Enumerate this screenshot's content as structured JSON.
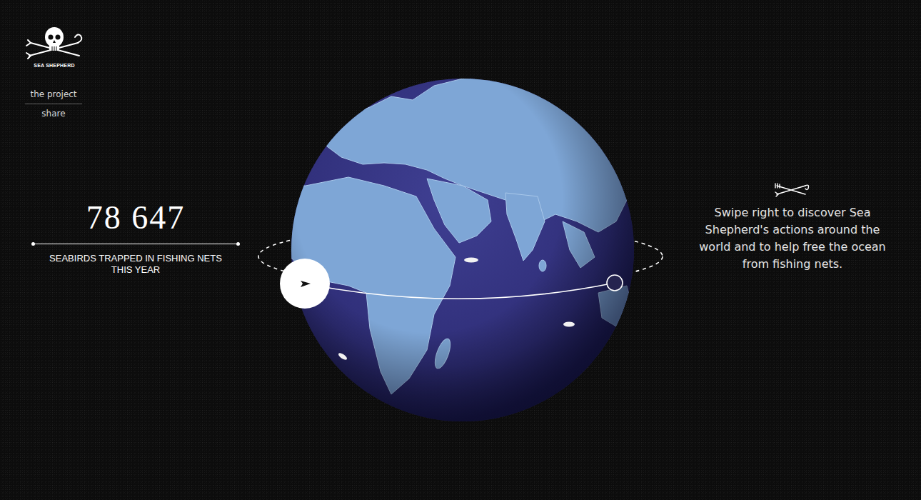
{
  "brand": {
    "name": "SEA SHEPHERD"
  },
  "nav": [
    {
      "label": "the project"
    },
    {
      "label": "share"
    }
  ],
  "counter": {
    "value": "78 647",
    "label": "SEABIRDS TRAPPED IN FISHING NETS THIS YEAR"
  },
  "hint": {
    "text": "Swipe right to discover Sea Shepherd's actions around the world and to help free the ocean from fishing nets."
  }
}
